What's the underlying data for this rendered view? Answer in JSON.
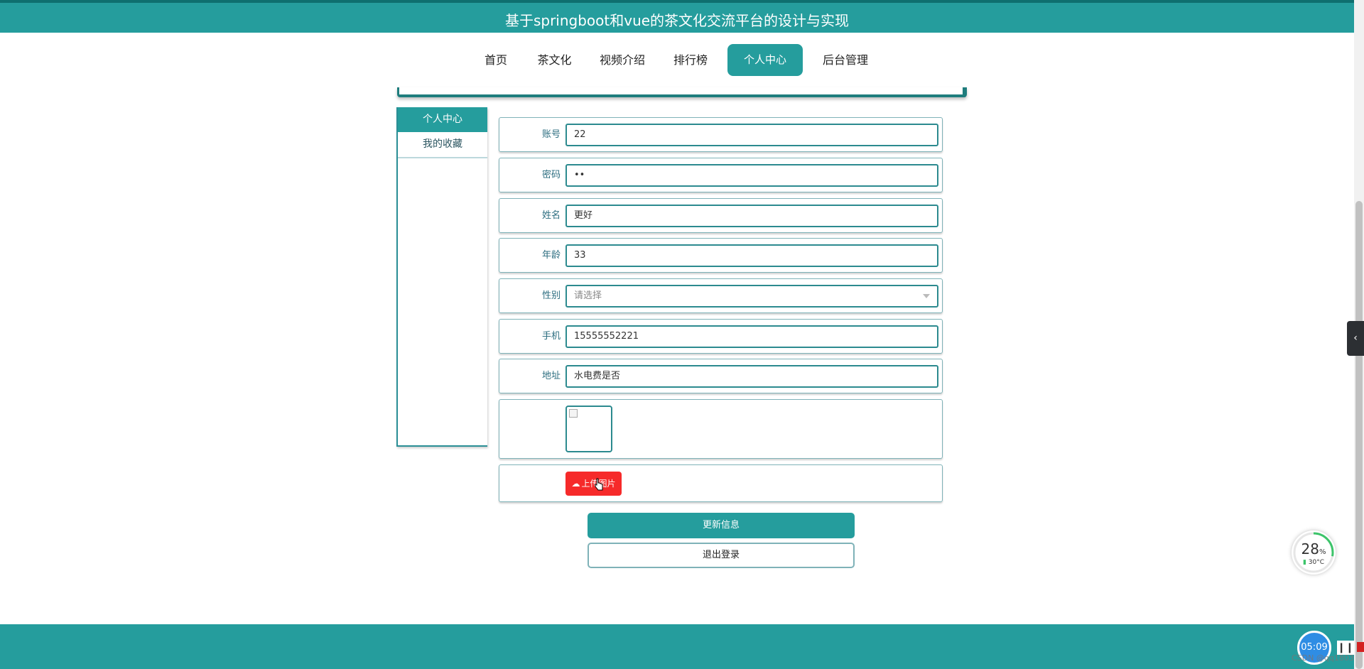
{
  "header": {
    "title": "基于springboot和vue的茶文化交流平台的设计与实现"
  },
  "nav": {
    "items": [
      {
        "label": "首页"
      },
      {
        "label": "茶文化"
      },
      {
        "label": "视频介绍"
      },
      {
        "label": "排行榜"
      },
      {
        "label": "个人中心",
        "active": true
      },
      {
        "label": "后台管理"
      }
    ]
  },
  "sidebar": {
    "items": [
      {
        "label": "个人中心",
        "active": true
      },
      {
        "label": "我的收藏"
      }
    ]
  },
  "form": {
    "account": {
      "label": "账号",
      "value": "22"
    },
    "password": {
      "label": "密码",
      "value": "••"
    },
    "name": {
      "label": "姓名",
      "value": "更好"
    },
    "age": {
      "label": "年龄",
      "value": "33"
    },
    "gender": {
      "label": "性别",
      "placeholder": "请选择"
    },
    "phone": {
      "label": "手机",
      "value": "15555552221"
    },
    "address": {
      "label": "地址",
      "value": "水电费是否"
    },
    "upload_label": "上传图片"
  },
  "actions": {
    "update": "更新信息",
    "logout": "退出登录"
  },
  "overlay": {
    "meter_percent": "28",
    "meter_percent_unit": "%",
    "meter_temp": "30°C",
    "clock": "05:09",
    "watermark": "CSDN @qq1803"
  },
  "colors": {
    "primary": "#259d9d",
    "upload": "#f62a2a"
  }
}
